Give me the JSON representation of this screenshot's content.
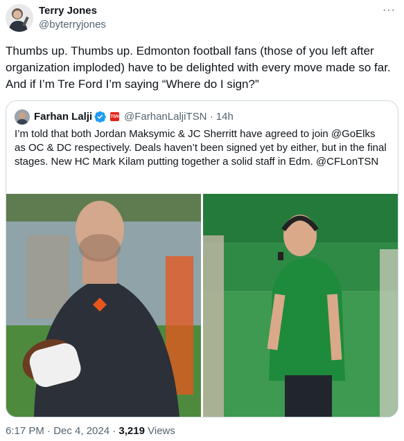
{
  "author": {
    "name": "Terry Jones",
    "handle": "@byterryjones"
  },
  "more_label": "···",
  "tweet_text": "Thumbs up. Thumbs up. Edmonton football fans (those of you left after organization imploded) have to be delighted with every move made so far. And if I’m Tre Ford I’m saying “Where do I sign?”",
  "quote": {
    "name": "Farhan Lalji",
    "handle_time": "@FarhanLaljiTSN · 14h",
    "badge": "TSN",
    "text": "I’m told that both Jordan Maksymic & JC Sherritt have agreed to join @GoElks as OC & DC respectively. Deals haven’t been signed yet by either, but in the final stages. New HC Mark Kilam putting together a solid staff in Edm. @CFLonTSN"
  },
  "footer": {
    "timestamp": "6:17 PM · Dec 4, 2024 · ",
    "views_count": "3,219",
    "views_label": " Views"
  },
  "colors": {
    "verified": "#1d9bf0",
    "tsn": "#e1251b",
    "lions_orange": "#e8561c",
    "rider_green": "#1e8a3c"
  },
  "icons": [
    "verified-badge-icon",
    "tsn-logo-icon",
    "more-icon"
  ]
}
